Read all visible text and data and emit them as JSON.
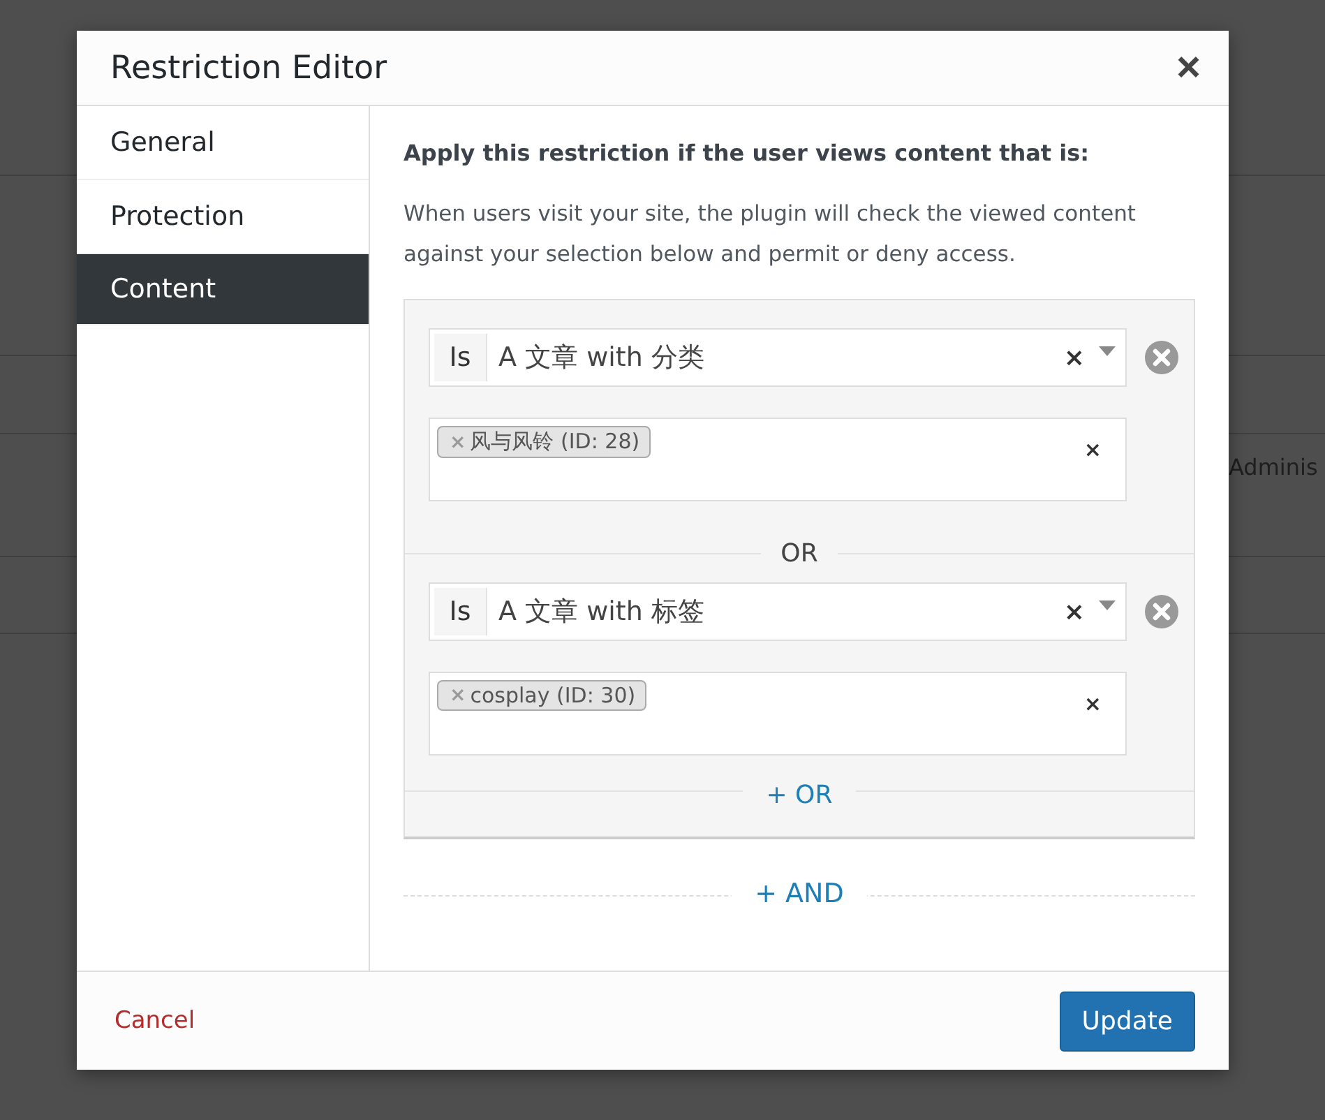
{
  "background": {
    "text": "Adminis"
  },
  "dialog": {
    "title": "Restriction Editor",
    "close": "×"
  },
  "tabs": [
    {
      "label": "General",
      "selected": false
    },
    {
      "label": "Protection",
      "selected": false
    },
    {
      "label": "Content",
      "selected": true
    }
  ],
  "content": {
    "heading": "Apply this restriction if the user views content that is:",
    "description": "When users visit your site, the plugin will check the viewed content against your selection below and permit or deny access.",
    "conditions": [
      {
        "operator": "Is",
        "value": "A 文章 with 分类",
        "clear": "×",
        "tags": [
          {
            "remove": "×",
            "label": "风与风铃 (ID: 28)"
          }
        ],
        "tags_clear": "×"
      },
      {
        "operator": "Is",
        "value": "A 文章 with 标签",
        "clear": "×",
        "tags": [
          {
            "remove": "×",
            "label": "cosplay (ID: 30)"
          }
        ],
        "tags_clear": "×"
      }
    ],
    "or_separators": [
      "OR"
    ],
    "add_or": "+ OR",
    "add_and": "+ AND"
  },
  "footer": {
    "cancel": "Cancel",
    "update": "Update"
  }
}
